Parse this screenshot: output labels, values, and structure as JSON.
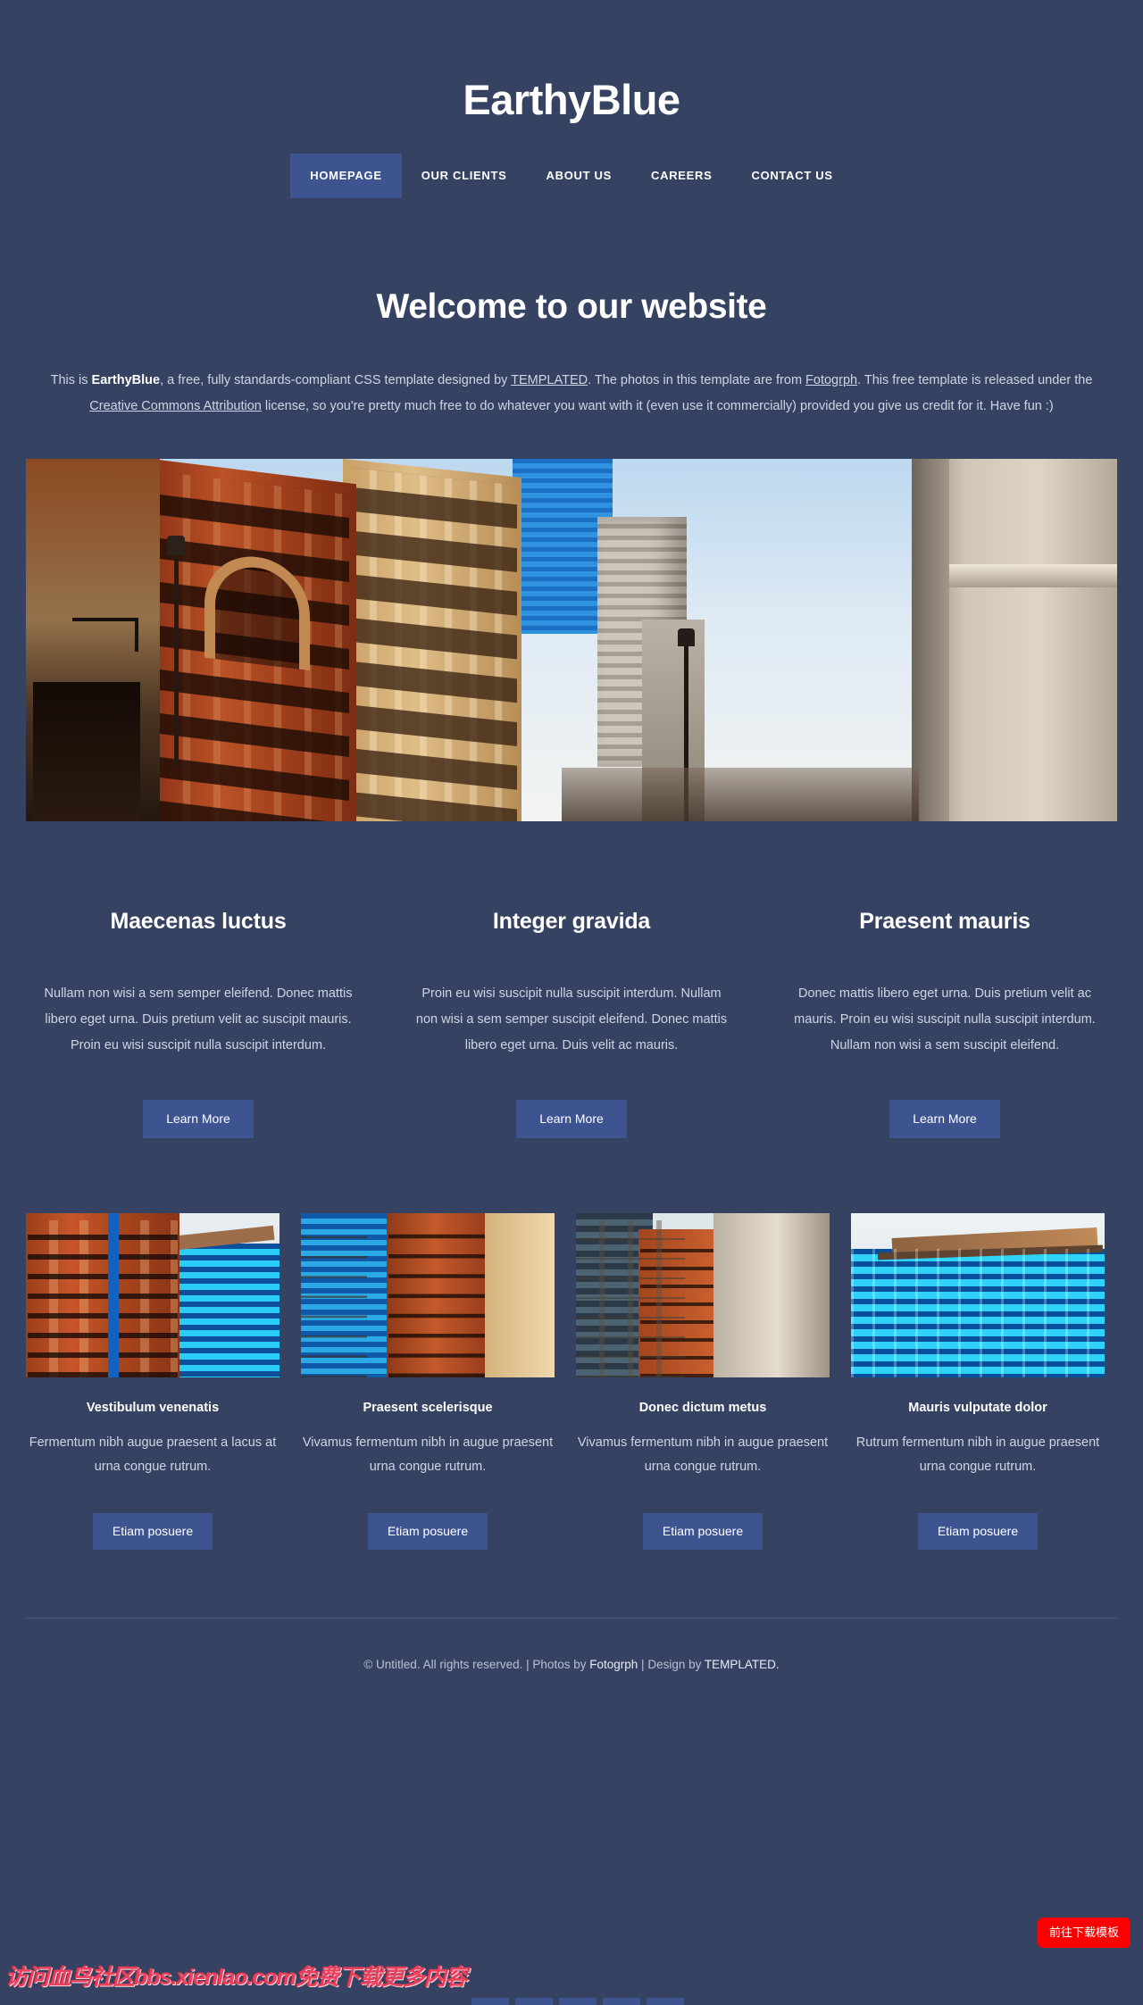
{
  "theme": {
    "page_bg": "#364261",
    "accent": "#3d5490",
    "text": "#cfd5e4",
    "heading": "#ffffff",
    "rule": "#4c5878",
    "download_red": "#fa0000",
    "watermark_red": "#e8415e"
  },
  "header": {
    "logo": "EarthyBlue",
    "nav": [
      {
        "label": "HOMEPAGE",
        "active": true
      },
      {
        "label": "OUR CLIENTS",
        "active": false
      },
      {
        "label": "ABOUT US",
        "active": false
      },
      {
        "label": "CAREERS",
        "active": false
      },
      {
        "label": "CONTACT US",
        "active": false
      }
    ]
  },
  "banner": {
    "heading": "Welcome to our website",
    "intro": {
      "part1": "This is ",
      "brand": "EarthyBlue",
      "part2": ", a free, fully standards-compliant CSS template designed by ",
      "link_templated": "TEMPLATED",
      "part3": ". The photos in this template are from ",
      "link_fotogrph": "Fotogrph",
      "part4": ". This free template is released under the ",
      "link_cc": "Creative Commons Attribution",
      "part5": " license, so you're pretty much free to do whatever you want with it (even use it commercially) provided you give us credit for it. Have fun :)"
    },
    "image_alt": "city-street-historic-buildings"
  },
  "features": [
    {
      "title": "Maecenas luctus",
      "body": "Nullam non wisi a sem semper eleifend. Donec mattis libero eget urna. Duis pretium velit ac suscipit mauris. Proin eu wisi suscipit nulla suscipit interdum.",
      "button": "Learn More"
    },
    {
      "title": "Integer gravida",
      "body": "Proin eu wisi suscipit nulla suscipit interdum. Nullam non wisi a sem semper suscipit eleifend. Donec mattis libero eget urna. Duis velit ac mauris.",
      "button": "Learn More"
    },
    {
      "title": "Praesent mauris",
      "body": "Donec mattis libero eget urna. Duis pretium velit ac mauris. Proin eu wisi suscipit nulla suscipit interdum. Nullam non wisi a sem suscipit eleifend.",
      "button": "Learn More"
    }
  ],
  "thumbs": [
    {
      "title": "Vestibulum venenatis",
      "body": "Fermentum nibh augue praesent a lacus at urna congue rutrum.",
      "button": "Etiam posuere",
      "image_alt": "brick-building-and-blue-glass-tower"
    },
    {
      "title": "Praesent scelerisque",
      "body": "Vivamus fermentum nibh in augue praesent urna congue rutrum.",
      "button": "Etiam posuere",
      "image_alt": "blue-glass-facade-and-brick-building"
    },
    {
      "title": "Donec dictum metus",
      "body": "Vivamus fermentum nibh in augue praesent urna congue rutrum.",
      "button": "Etiam posuere",
      "image_alt": "mixed-downtown-facades"
    },
    {
      "title": "Mauris vulputate dolor",
      "body": "Rutrum fermentum nibh in augue praesent urna congue rutrum.",
      "button": "Etiam posuere",
      "image_alt": "cyan-glass-skyscraper"
    }
  ],
  "footer": {
    "copyright": "© Untitled. All rights reserved.",
    "sep1": "|",
    "photos_prefix": "Photos by",
    "photos_link": "Fotogrph",
    "sep2": "|",
    "design_prefix": "Design by",
    "design_link": "TEMPLATED."
  },
  "overlays": {
    "watermark": "访问血鸟社区bbs.xienlao.com免费下载更多内容",
    "download_button": "前往下载模板"
  }
}
